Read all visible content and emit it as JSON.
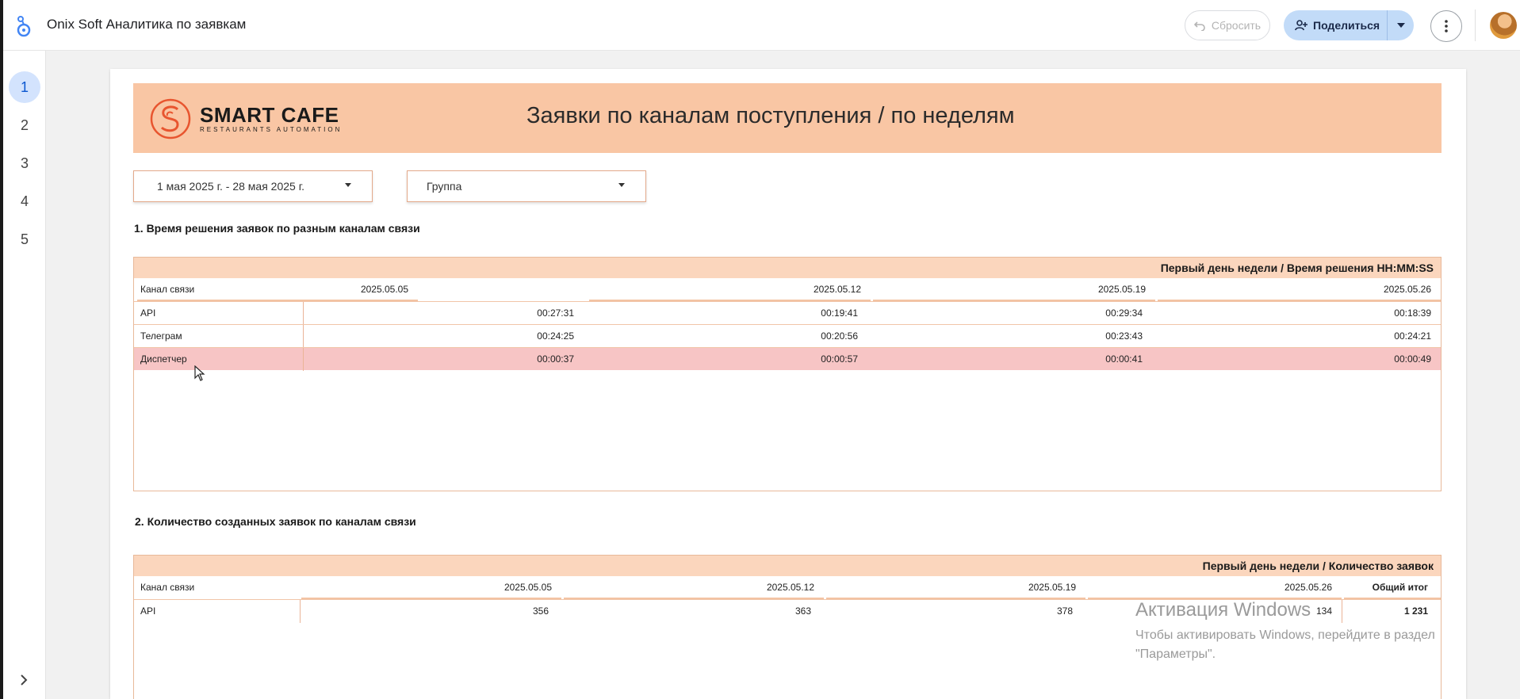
{
  "app": {
    "title": "Onix Soft Аналитика по заявкам"
  },
  "toolbar": {
    "reset_label": "Сбросить",
    "share_label": "Поделиться"
  },
  "pages": [
    "1",
    "2",
    "3",
    "4",
    "5"
  ],
  "report": {
    "brand_name": "SMART CAFE",
    "brand_tagline": "RESTAURANTS AUTOMATION",
    "title": "Заявки по каналам поступления / по неделям",
    "filters": {
      "date_range": "1 мая 2025 г. - 28 мая 2025 г.",
      "group": "Группа"
    }
  },
  "section1": {
    "title": "1. Время решения заявок по разным каналам связи",
    "header": "Первый день недели / Время решения HH:MM:SS",
    "dim_label": "Канал связи",
    "weeks": [
      "2025.05.05",
      "2025.05.12",
      "2025.05.19",
      "2025.05.26"
    ],
    "rows": [
      {
        "channel": "API",
        "values": [
          "00:27:31",
          "00:19:41",
          "00:29:34",
          "00:18:39"
        ]
      },
      {
        "channel": "Телеграм",
        "values": [
          "00:24:25",
          "00:20:56",
          "00:23:43",
          "00:24:21"
        ]
      },
      {
        "channel": "Диспетчер",
        "values": [
          "00:00:37",
          "00:00:57",
          "00:00:41",
          "00:00:49"
        ]
      }
    ]
  },
  "section2": {
    "title": "2. Количество созданных заявок по каналам связи",
    "header": "Первый день недели / Количество заявок",
    "dim_label": "Канал связи",
    "weeks": [
      "2025.05.05",
      "2025.05.12",
      "2025.05.19",
      "2025.05.26"
    ],
    "total_label": "Общий итог",
    "rows": [
      {
        "channel": "API",
        "values": [
          "356",
          "363",
          "378",
          "134"
        ],
        "total": "1 231"
      }
    ]
  },
  "watermark": {
    "line1": "Активация Windows",
    "line2": "Чтобы активировать Windows, перейдите в раздел",
    "line3": "\"Параметры\"."
  },
  "colors": {
    "header_band": "#f9c6a4",
    "table_header": "#fbd6bd",
    "highlight_row": "#f7c5c5",
    "share_button": "#c2dbf8"
  }
}
